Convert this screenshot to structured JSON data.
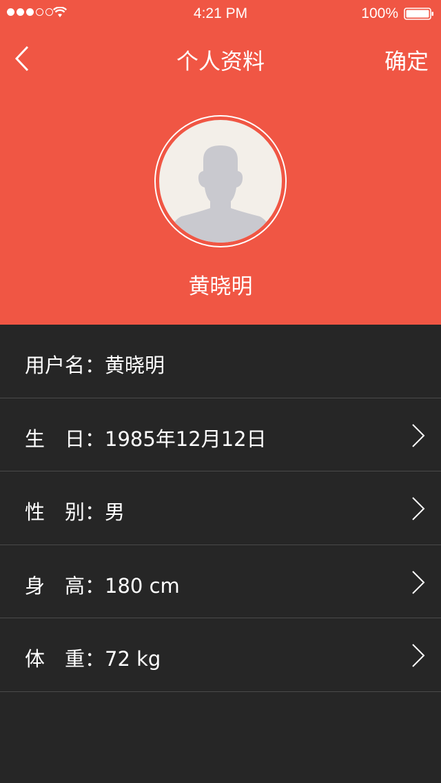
{
  "status_bar": {
    "time": "4:21 PM",
    "battery": "100%",
    "signal_icon": "signal-dots-icon",
    "wifi_icon": "wifi-icon",
    "battery_icon": "battery-icon"
  },
  "nav": {
    "back_icon": "back-chevron-icon",
    "title": "个人资料",
    "confirm": "确定"
  },
  "profile": {
    "avatar_icon": "avatar-placeholder-icon",
    "name": "黄晓明"
  },
  "rows": [
    {
      "text": "用户名：黄晓明",
      "has_arrow": false
    },
    {
      "text": "生　日：1985年12月12日",
      "has_arrow": true
    },
    {
      "text": "性　别：男",
      "has_arrow": true
    },
    {
      "text": "身　高：180 cm",
      "has_arrow": true
    },
    {
      "text": "体　重：72 kg",
      "has_arrow": true
    }
  ],
  "colors": {
    "header_bg": "#f05644",
    "body_bg": "#262626",
    "divider": "#4a4a4a",
    "avatar_bg": "#f3efe9",
    "avatar_silhouette": "#c9c9cf"
  }
}
